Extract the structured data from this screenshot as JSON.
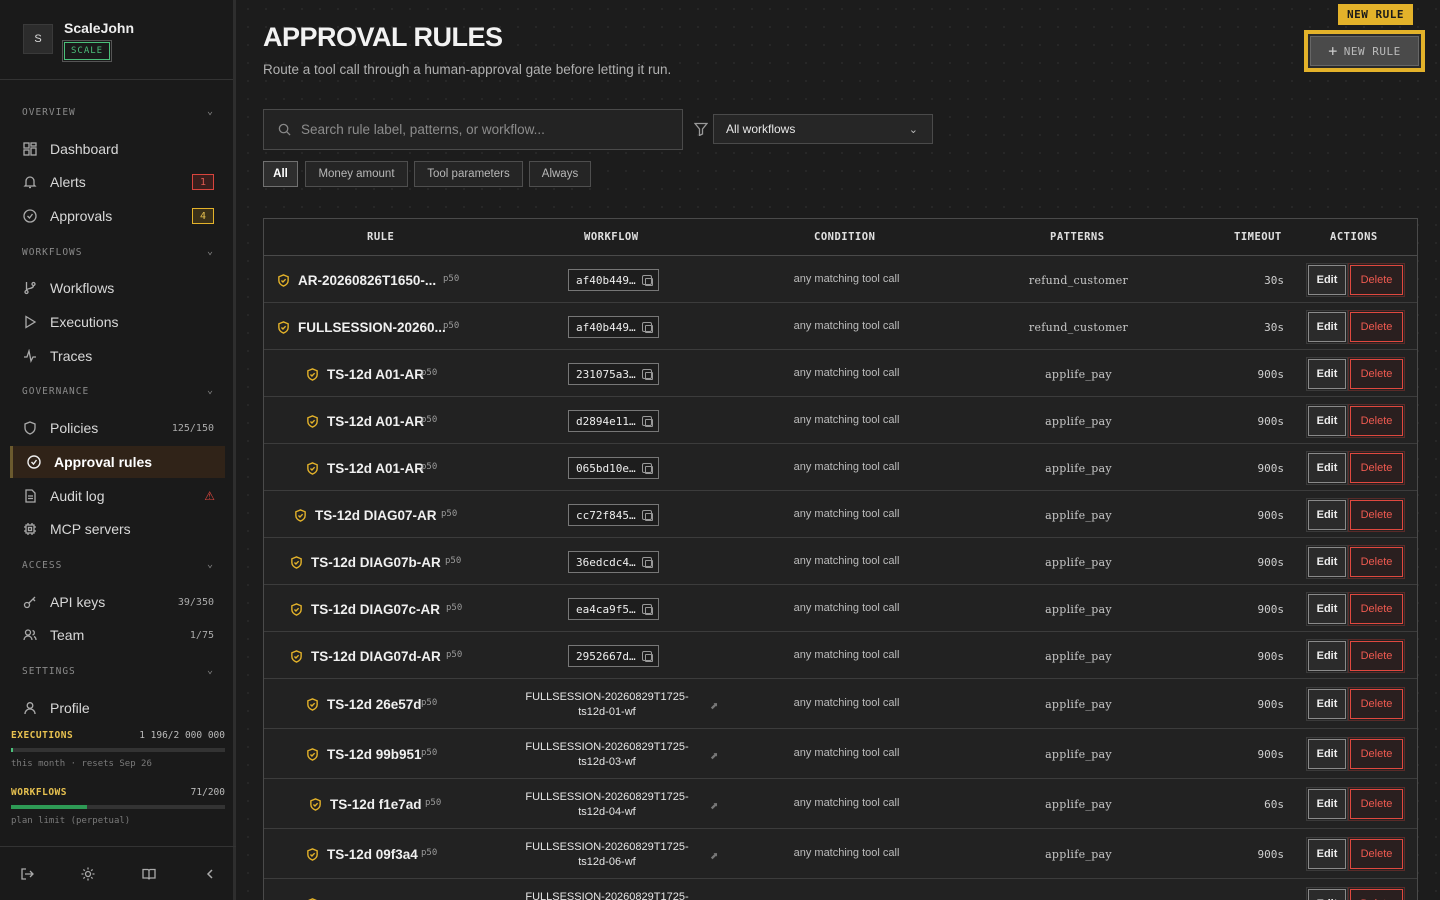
{
  "workspace": {
    "avatar": "S",
    "name": "ScaleJohn",
    "plan": "SCALE"
  },
  "sidebar": {
    "sections": {
      "overview": "OVERVIEW",
      "workflows": "WORKFLOWS",
      "governance": "GOVERNANCE",
      "access": "ACCESS",
      "settings": "SETTINGS"
    },
    "items": [
      {
        "label": "Dashboard",
        "icon": "dashboard-icon"
      },
      {
        "label": "Alerts",
        "icon": "bell-icon",
        "badge": "1"
      },
      {
        "label": "Approvals",
        "icon": "check-circle-icon",
        "badge": "4"
      },
      {
        "label": "Workflows",
        "icon": "branch-icon"
      },
      {
        "label": "Executions",
        "icon": "play-icon"
      },
      {
        "label": "Traces",
        "icon": "activity-icon"
      },
      {
        "label": "Policies",
        "icon": "shield-icon",
        "count": "125/150"
      },
      {
        "label": "Approval rules",
        "icon": "check-circle-icon",
        "active": true
      },
      {
        "label": "Audit log",
        "icon": "document-icon",
        "warning": "⚠"
      },
      {
        "label": "MCP servers",
        "icon": "chip-icon"
      },
      {
        "label": "API keys",
        "icon": "key-icon",
        "count": "39/350"
      },
      {
        "label": "Team",
        "icon": "users-icon",
        "count": "1/75"
      },
      {
        "label": "Profile",
        "icon": "user-icon"
      }
    ],
    "usage": {
      "executions": {
        "label": "EXECUTIONS",
        "value": "1 196/2 000 000",
        "sub": "this month · resets Sep 26",
        "fraction": 0.0006,
        "color": "#4bc07a"
      },
      "workflows": {
        "label": "WORKFLOWS",
        "value": "71/200",
        "sub": "plan limit (perpetual)",
        "fraction": 0.355,
        "color": "#2e9a55"
      }
    }
  },
  "header": {
    "title": "APPROVAL RULES",
    "subtitle": "Route a tool call through a human-approval gate before letting it run.",
    "new_tag": "NEW RULE",
    "new_button": "NEW RULE"
  },
  "search": {
    "placeholder": "Search rule label, patterns, or workflow..."
  },
  "filter": {
    "selected": "All workflows"
  },
  "chips": [
    "All",
    "Money amount",
    "Tool parameters",
    "Always"
  ],
  "table": {
    "columns": [
      "RULE",
      "WORKFLOW",
      "CONDITION",
      "PATTERNS",
      "TIMEOUT",
      "ACTIONS"
    ],
    "edit_label": "Edit",
    "delete_label": "Delete",
    "rows": [
      {
        "rule": "AR-20260826T1650-...",
        "p": "p50",
        "workflow": "af40b449…",
        "wf_type": "id",
        "condition": "any matching tool call",
        "pattern": "refund_customer",
        "timeout": "30s"
      },
      {
        "rule": "FULLSESSION-20260...",
        "p": "p50",
        "workflow": "af40b449…",
        "wf_type": "id",
        "condition": "any matching tool call",
        "pattern": "refund_customer",
        "timeout": "30s"
      },
      {
        "rule": "TS-12d A01-AR",
        "p": "p50",
        "workflow": "231075a3…",
        "wf_type": "id",
        "condition": "any matching tool call",
        "pattern": "applife_pay",
        "timeout": "900s"
      },
      {
        "rule": "TS-12d A01-AR",
        "p": "p50",
        "workflow": "d2894e11…",
        "wf_type": "id",
        "condition": "any matching tool call",
        "pattern": "applife_pay",
        "timeout": "900s"
      },
      {
        "rule": "TS-12d A01-AR",
        "p": "p50",
        "workflow": "065bd10e…",
        "wf_type": "id",
        "condition": "any matching tool call",
        "pattern": "applife_pay",
        "timeout": "900s"
      },
      {
        "rule": "TS-12d DIAG07-AR",
        "p": "p50",
        "workflow": "cc72f845…",
        "wf_type": "id",
        "condition": "any matching tool call",
        "pattern": "applife_pay",
        "timeout": "900s"
      },
      {
        "rule": "TS-12d DIAG07b-AR",
        "p": "p50",
        "workflow": "36edcdc4…",
        "wf_type": "id",
        "condition": "any matching tool call",
        "pattern": "applife_pay",
        "timeout": "900s"
      },
      {
        "rule": "TS-12d DIAG07c-AR",
        "p": "p50",
        "workflow": "ea4ca9f5…",
        "wf_type": "id",
        "condition": "any matching tool call",
        "pattern": "applife_pay",
        "timeout": "900s"
      },
      {
        "rule": "TS-12d DIAG07d-AR",
        "p": "p50",
        "workflow": "2952667d…",
        "wf_type": "id",
        "condition": "any matching tool call",
        "pattern": "applife_pay",
        "timeout": "900s"
      },
      {
        "rule": "TS-12d 26e57d",
        "p": "p50",
        "workflow": "FULLSESSION-20260829T1725-ts12d-01-wf",
        "wf_type": "name",
        "condition": "any matching tool call",
        "pattern": "applife_pay",
        "timeout": "900s"
      },
      {
        "rule": "TS-12d 99b951",
        "p": "p50",
        "workflow": "FULLSESSION-20260829T1725-ts12d-03-wf",
        "wf_type": "name",
        "condition": "any matching tool call",
        "pattern": "applife_pay",
        "timeout": "900s"
      },
      {
        "rule": "TS-12d f1e7ad",
        "p": "p50",
        "workflow": "FULLSESSION-20260829T1725-ts12d-04-wf",
        "wf_type": "name",
        "condition": "any matching tool call",
        "pattern": "applife_pay",
        "timeout": "60s"
      },
      {
        "rule": "TS-12d 09f3a4",
        "p": "p50",
        "workflow": "FULLSESSION-20260829T1725-ts12d-06-wf",
        "wf_type": "name",
        "condition": "any matching tool call",
        "pattern": "applife_pay",
        "timeout": "900s"
      },
      {
        "rule": "",
        "p": "",
        "workflow": "FULLSESSION-20260829T1725-",
        "wf_type": "name",
        "condition": "",
        "pattern": "",
        "timeout": ""
      }
    ]
  }
}
